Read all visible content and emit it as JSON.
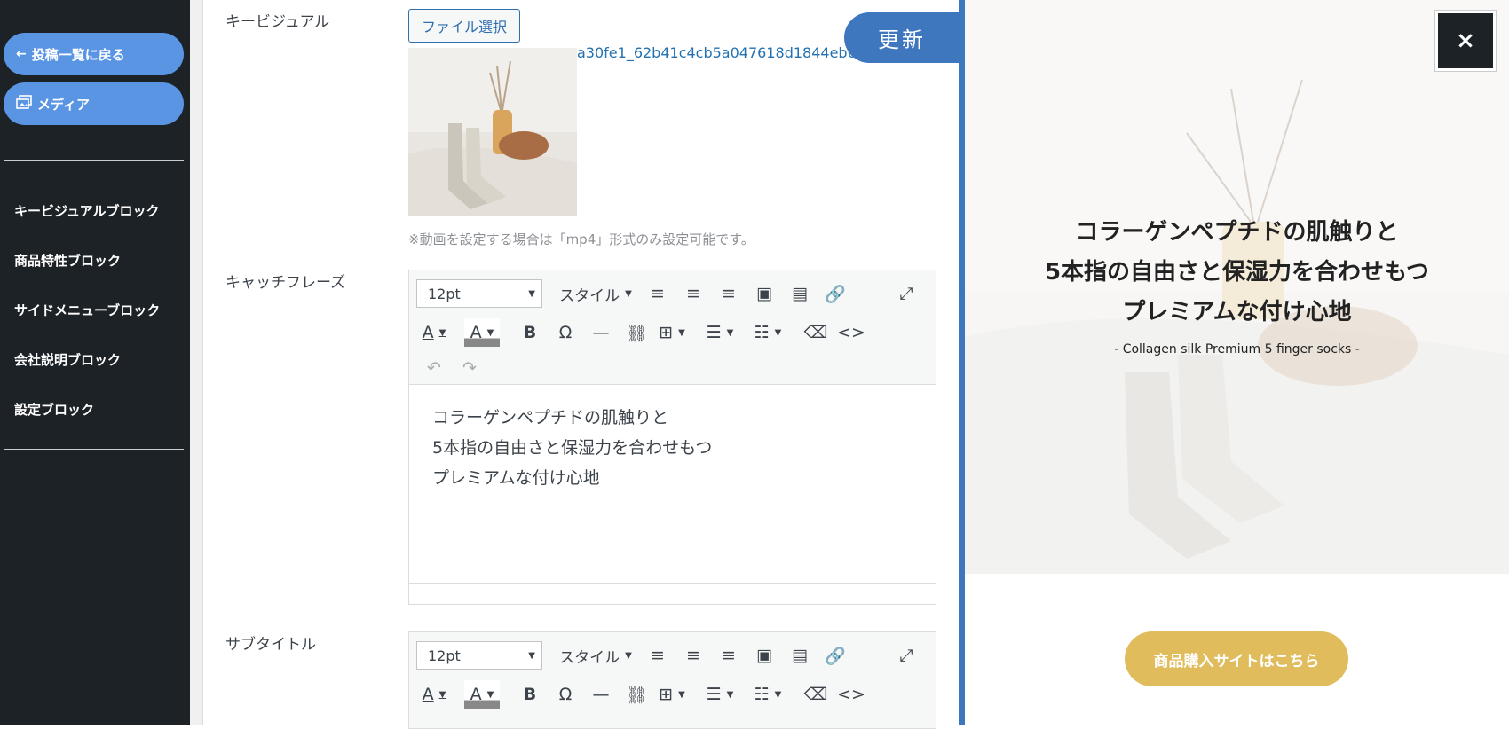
{
  "sidebar": {
    "back_label": "投稿一覧に戻る",
    "media_label": "メディア",
    "items": [
      {
        "label": "キービジュアルブロック"
      },
      {
        "label": "商品特性ブロック"
      },
      {
        "label": "サイドメニューブロック"
      },
      {
        "label": "会社説明ブロック"
      },
      {
        "label": "設定ブロック"
      }
    ]
  },
  "editor": {
    "key_visual_label": "キービジュアル",
    "file_button": "ファイル選択",
    "file_link": "a30fe1_62b41c4cb5a047618d1844eb6...",
    "video_note": "※動画を設定する場合は「mp4」形式のみ設定可能です。",
    "update_button": "更新",
    "catch_label": "キャッチフレーズ",
    "subtitle_label": "サブタイトル",
    "toolbar": {
      "font_size": "12pt",
      "style_label": "スタイル"
    },
    "catch_text": [
      "コラーゲンペプチドの肌触りと",
      "5本指の自由さと保湿力を合わせもつ",
      "プレミアムな付け心地"
    ]
  },
  "preview": {
    "title_lines": [
      "コラーゲンペプチドの肌触りと",
      "5本指の自由さと保湿力を合わせもつ",
      "プレミアムな付け心地"
    ],
    "subtitle": "- Collagen silk Premium 5 finger socks -",
    "buy_button": "商品購入サイトはこちら",
    "close_label": "×"
  },
  "colors": {
    "sidebar_bg": "#1d2227",
    "pill": "#5a95e4",
    "accent_blue": "#3e77bd",
    "buy_gold": "#e0bc5c"
  }
}
